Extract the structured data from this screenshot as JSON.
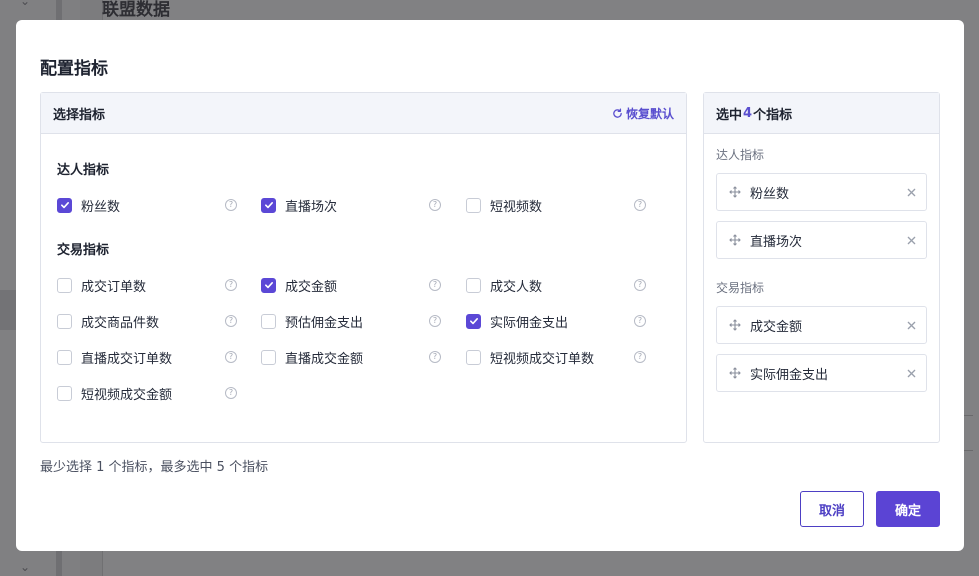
{
  "background": {
    "page_title": "联盟数据"
  },
  "modal": {
    "title": "配置指标",
    "left_panel": {
      "header": "选择指标",
      "reset_label": "恢复默认",
      "groups": [
        {
          "title": "达人指标",
          "options": [
            {
              "label": "粉丝数",
              "checked": true
            },
            {
              "label": "直播场次",
              "checked": true
            },
            {
              "label": "短视频数",
              "checked": false
            }
          ]
        },
        {
          "title": "交易指标",
          "options": [
            {
              "label": "成交订单数",
              "checked": false
            },
            {
              "label": "成交金额",
              "checked": true
            },
            {
              "label": "成交人数",
              "checked": false
            },
            {
              "label": "成交商品件数",
              "checked": false
            },
            {
              "label": "预估佣金支出",
              "checked": false
            },
            {
              "label": "实际佣金支出",
              "checked": true
            },
            {
              "label": "直播成交订单数",
              "checked": false
            },
            {
              "label": "直播成交金额",
              "checked": false
            },
            {
              "label": "短视频成交订单数",
              "checked": false
            },
            {
              "label": "短视频成交金额",
              "checked": false
            }
          ]
        }
      ]
    },
    "hint": "最少选择 1 个指标，最多选中 5 个指标",
    "right_panel": {
      "header_prefix": "选中",
      "count": "4",
      "header_suffix": "个指标",
      "groups": [
        {
          "title": "达人指标",
          "items": [
            "粉丝数",
            "直播场次"
          ]
        },
        {
          "title": "交易指标",
          "items": [
            "成交金额",
            "实际佣金支出"
          ]
        }
      ]
    },
    "buttons": {
      "cancel": "取消",
      "confirm": "确定"
    },
    "colors": {
      "accent": "#5b44d4",
      "panel_header_bg": "#f3f5fa"
    }
  }
}
